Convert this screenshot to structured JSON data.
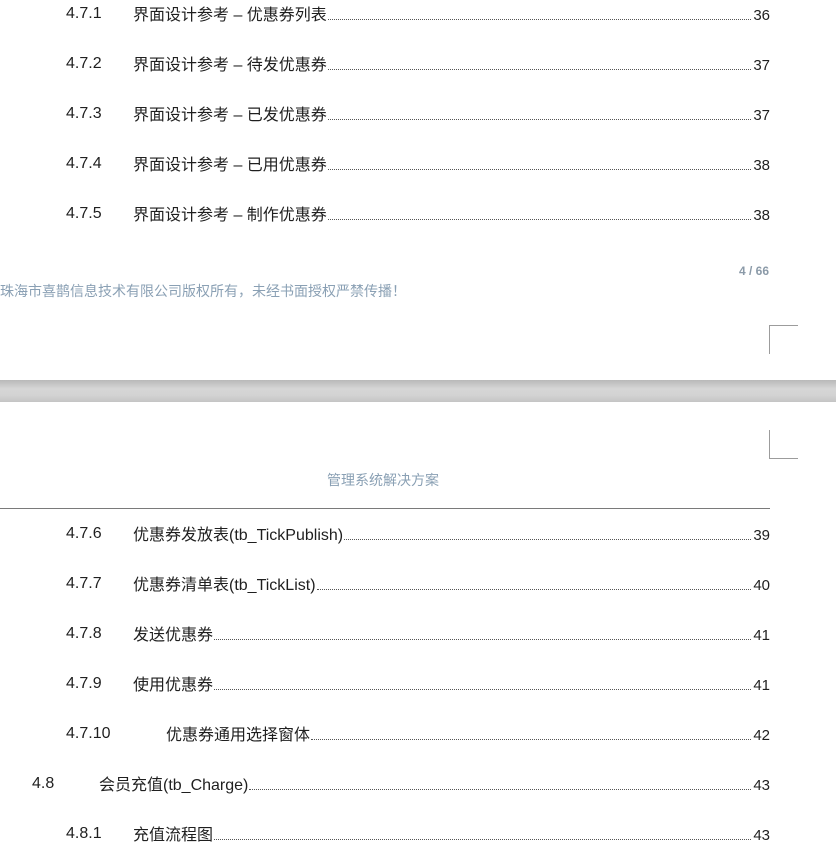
{
  "page1": {
    "toc": [
      {
        "num": "4.7.1",
        "title": "界面设计参考 – 优惠券列表",
        "page": "36"
      },
      {
        "num": "4.7.2",
        "title": "界面设计参考 – 待发优惠券",
        "page": "37"
      },
      {
        "num": "4.7.3",
        "title": "界面设计参考 – 已发优惠券",
        "page": "37"
      },
      {
        "num": "4.7.4",
        "title": "界面设计参考 – 已用优惠券",
        "page": "38"
      },
      {
        "num": "4.7.5",
        "title": "界面设计参考 – 制作优惠券",
        "page": "38"
      }
    ],
    "footer_text": "珠海市喜鹊信息技术有限公司版权所有，未经书面授权严禁传播！",
    "page_counter": "4 / 66"
  },
  "page2": {
    "header_title": "管理系统解决方案",
    "toc": [
      {
        "num": "4.7.6",
        "title": "优惠券发放表(tb_TickPublish)",
        "page": "39"
      },
      {
        "num": "4.7.7",
        "title": "优惠券清单表(tb_TickList)",
        "page": "40"
      },
      {
        "num": "4.7.8",
        "title": "发送优惠券",
        "page": "41"
      },
      {
        "num": "4.7.9",
        "title": "使用优惠券",
        "page": "41"
      },
      {
        "num": "4.7.10",
        "title": "优惠券通用选择窗体",
        "page": "42"
      },
      {
        "num": "4.8",
        "title": "会员充值(tb_Charge)",
        "page": "43"
      },
      {
        "num": "4.8.1",
        "title": "充值流程图",
        "page": "43"
      }
    ]
  }
}
